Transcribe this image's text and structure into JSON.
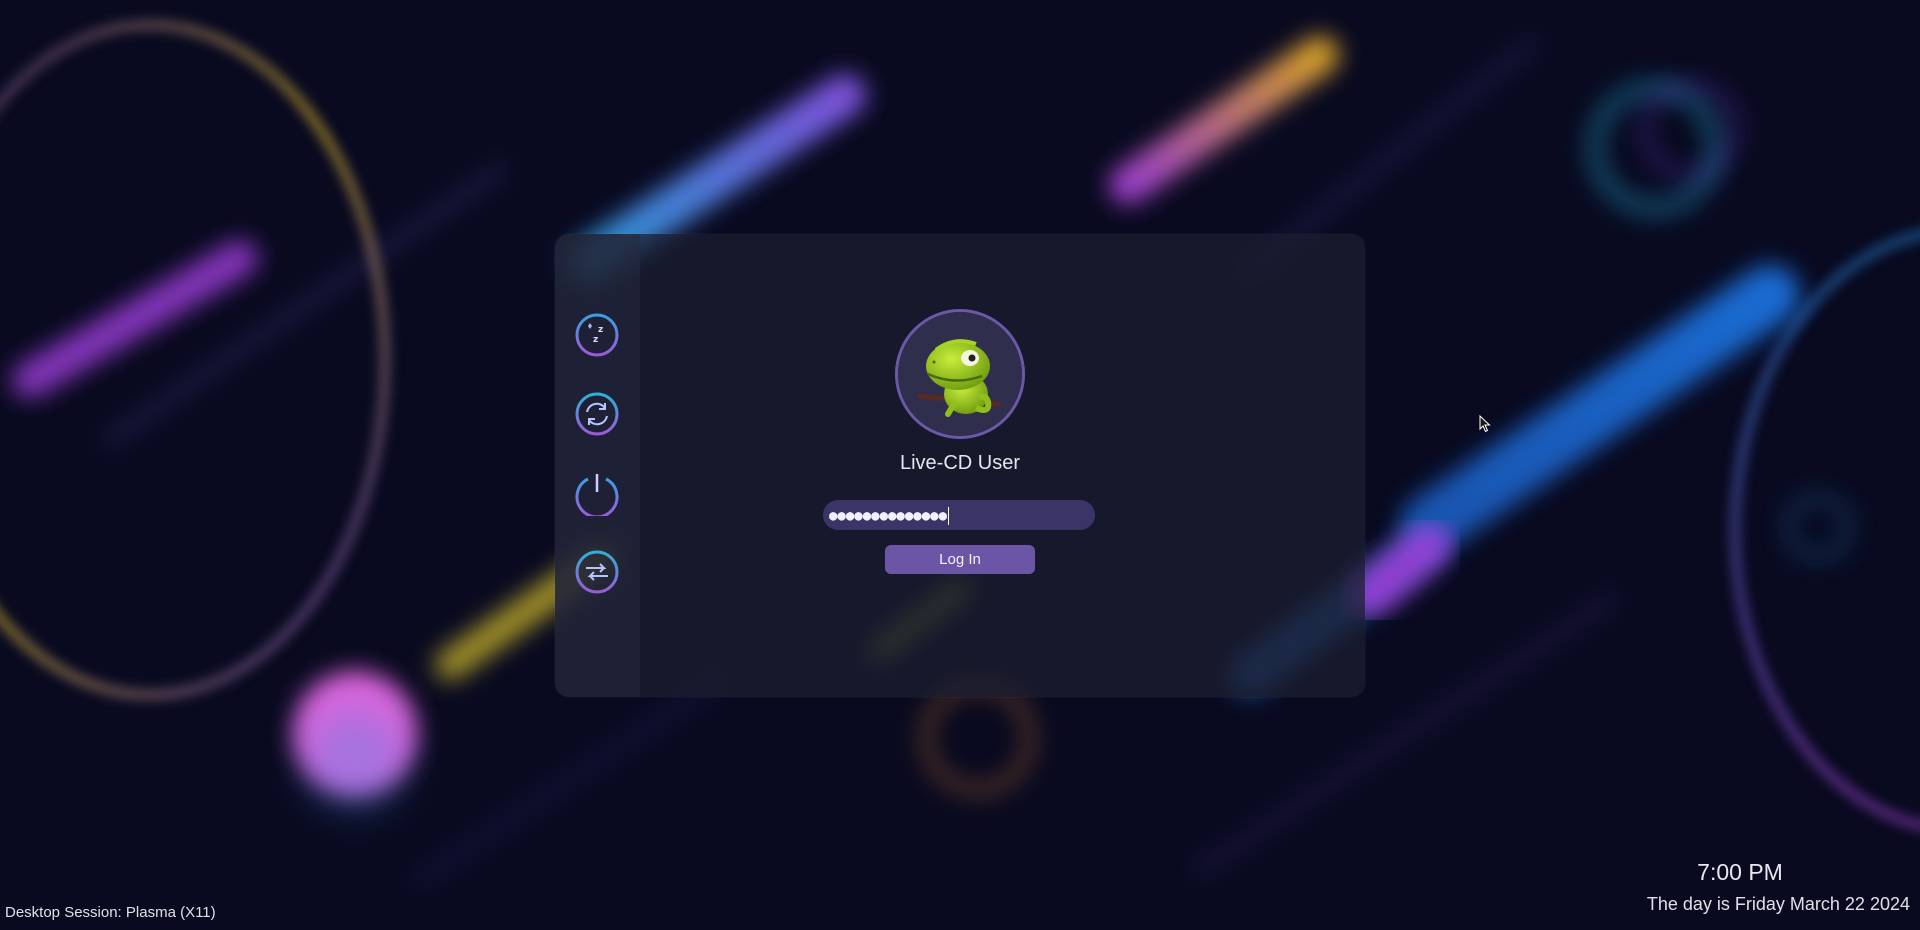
{
  "login": {
    "username": "Live-CD User",
    "password_mask": "●●●●●●●●●●●●●●",
    "login_label": "Log In"
  },
  "sidebar": {
    "items": [
      {
        "icon": "sleep-icon"
      },
      {
        "icon": "restart-icon"
      },
      {
        "icon": "power-icon"
      },
      {
        "icon": "switch-user-icon"
      }
    ]
  },
  "clock": {
    "time": "7:00 PM",
    "date": "The day is Friday March 22 2024"
  },
  "session": {
    "label": "Desktop Session: Plasma (X11)"
  },
  "colors": {
    "background": "#090a20",
    "accent": "#6b56a6",
    "field": "#3a3467"
  }
}
